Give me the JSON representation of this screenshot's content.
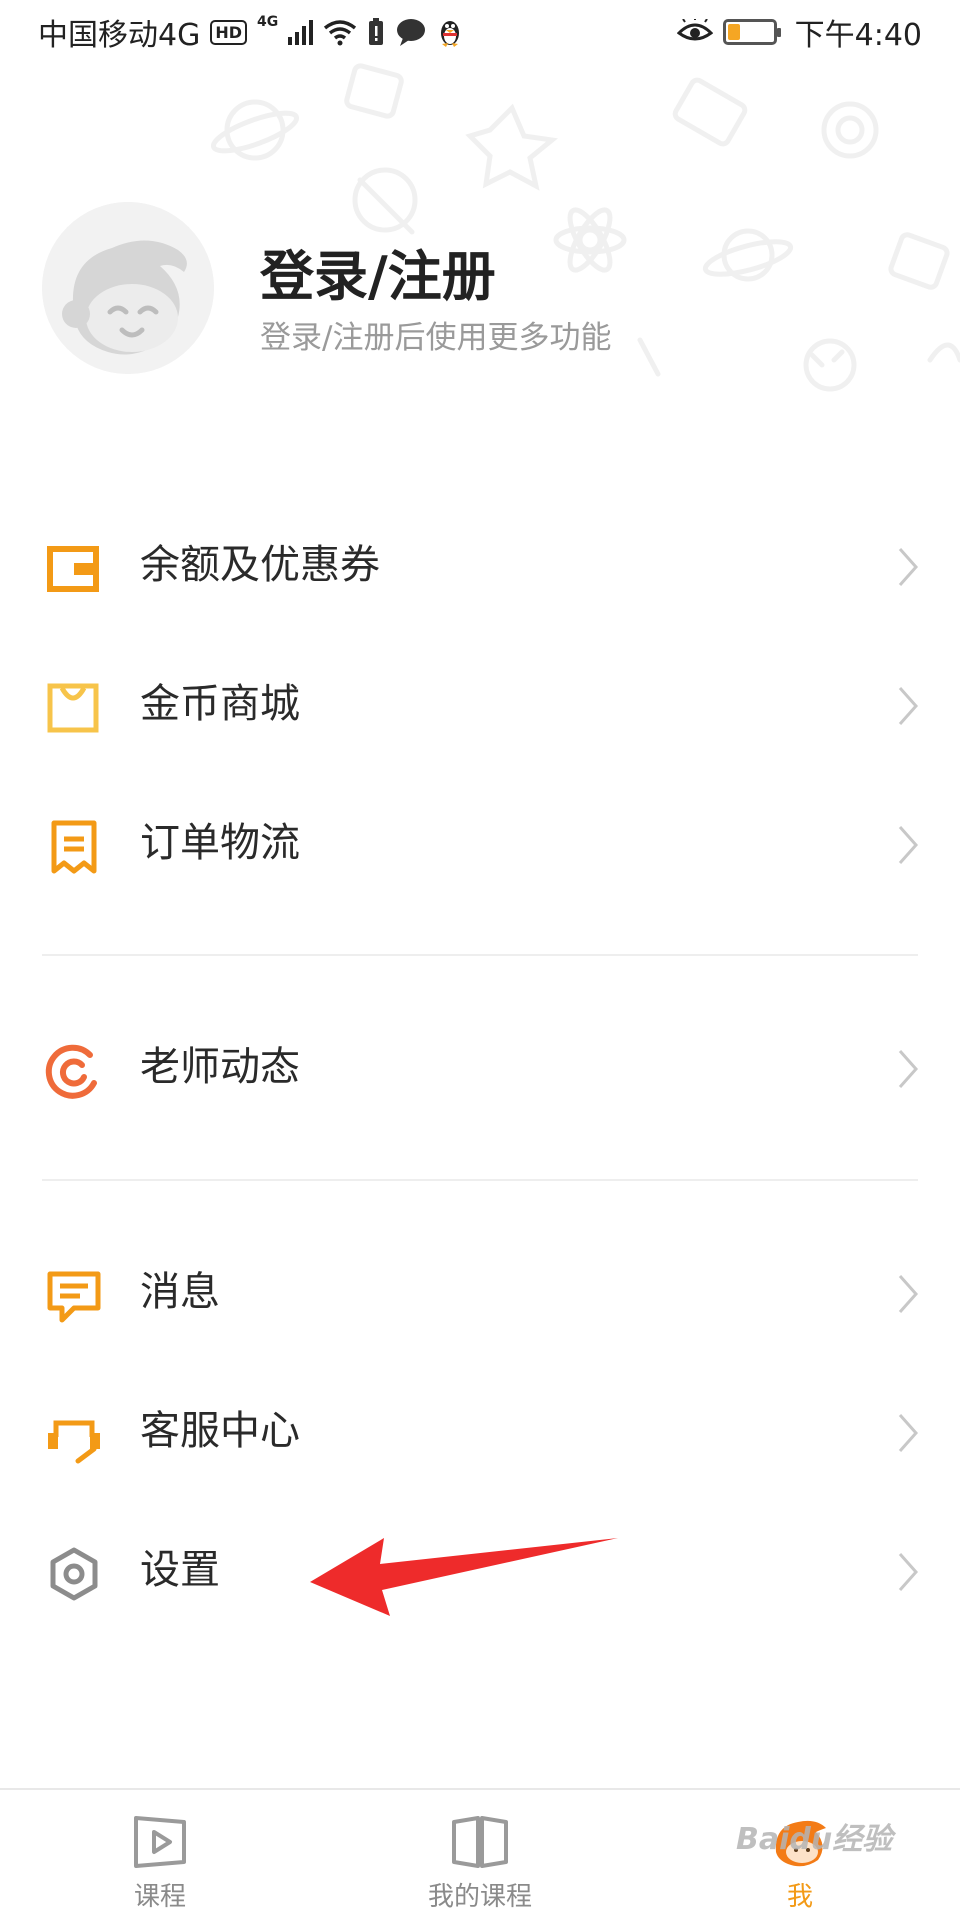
{
  "status_bar": {
    "carrier": "中国移动4G",
    "hd": "HD",
    "signal_tag": "4G",
    "time": "下午4:40"
  },
  "profile": {
    "title": "登录/注册",
    "subtitle": "登录/注册后使用更多功能"
  },
  "menu": {
    "items": [
      {
        "label": "余额及优惠券",
        "icon": "wallet-icon",
        "color": "#f39a16"
      },
      {
        "label": "金币商城",
        "icon": "shopping-bag-icon",
        "color": "#f7c44a"
      },
      {
        "label": "订单物流",
        "icon": "receipt-icon",
        "color": "#f39a16"
      },
      {
        "label": "老师动态",
        "icon": "teacher-feed-icon",
        "color": "#ef6b3a"
      },
      {
        "label": "消息",
        "icon": "message-icon",
        "color": "#f39a16"
      },
      {
        "label": "客服中心",
        "icon": "headset-icon",
        "color": "#f39a16"
      },
      {
        "label": "设置",
        "icon": "settings-hex-icon",
        "color": "#8c8c8c"
      }
    ]
  },
  "tabbar": {
    "tabs": [
      {
        "label": "课程",
        "icon": "play-icon",
        "active": false
      },
      {
        "label": "我的课程",
        "icon": "book-icon",
        "active": false
      },
      {
        "label": "我",
        "icon": "mascot-icon",
        "active": true
      }
    ]
  },
  "watermark": "Baidu经验",
  "colors": {
    "accent": "#f39a16",
    "annotation_arrow": "#ee2b2b"
  }
}
